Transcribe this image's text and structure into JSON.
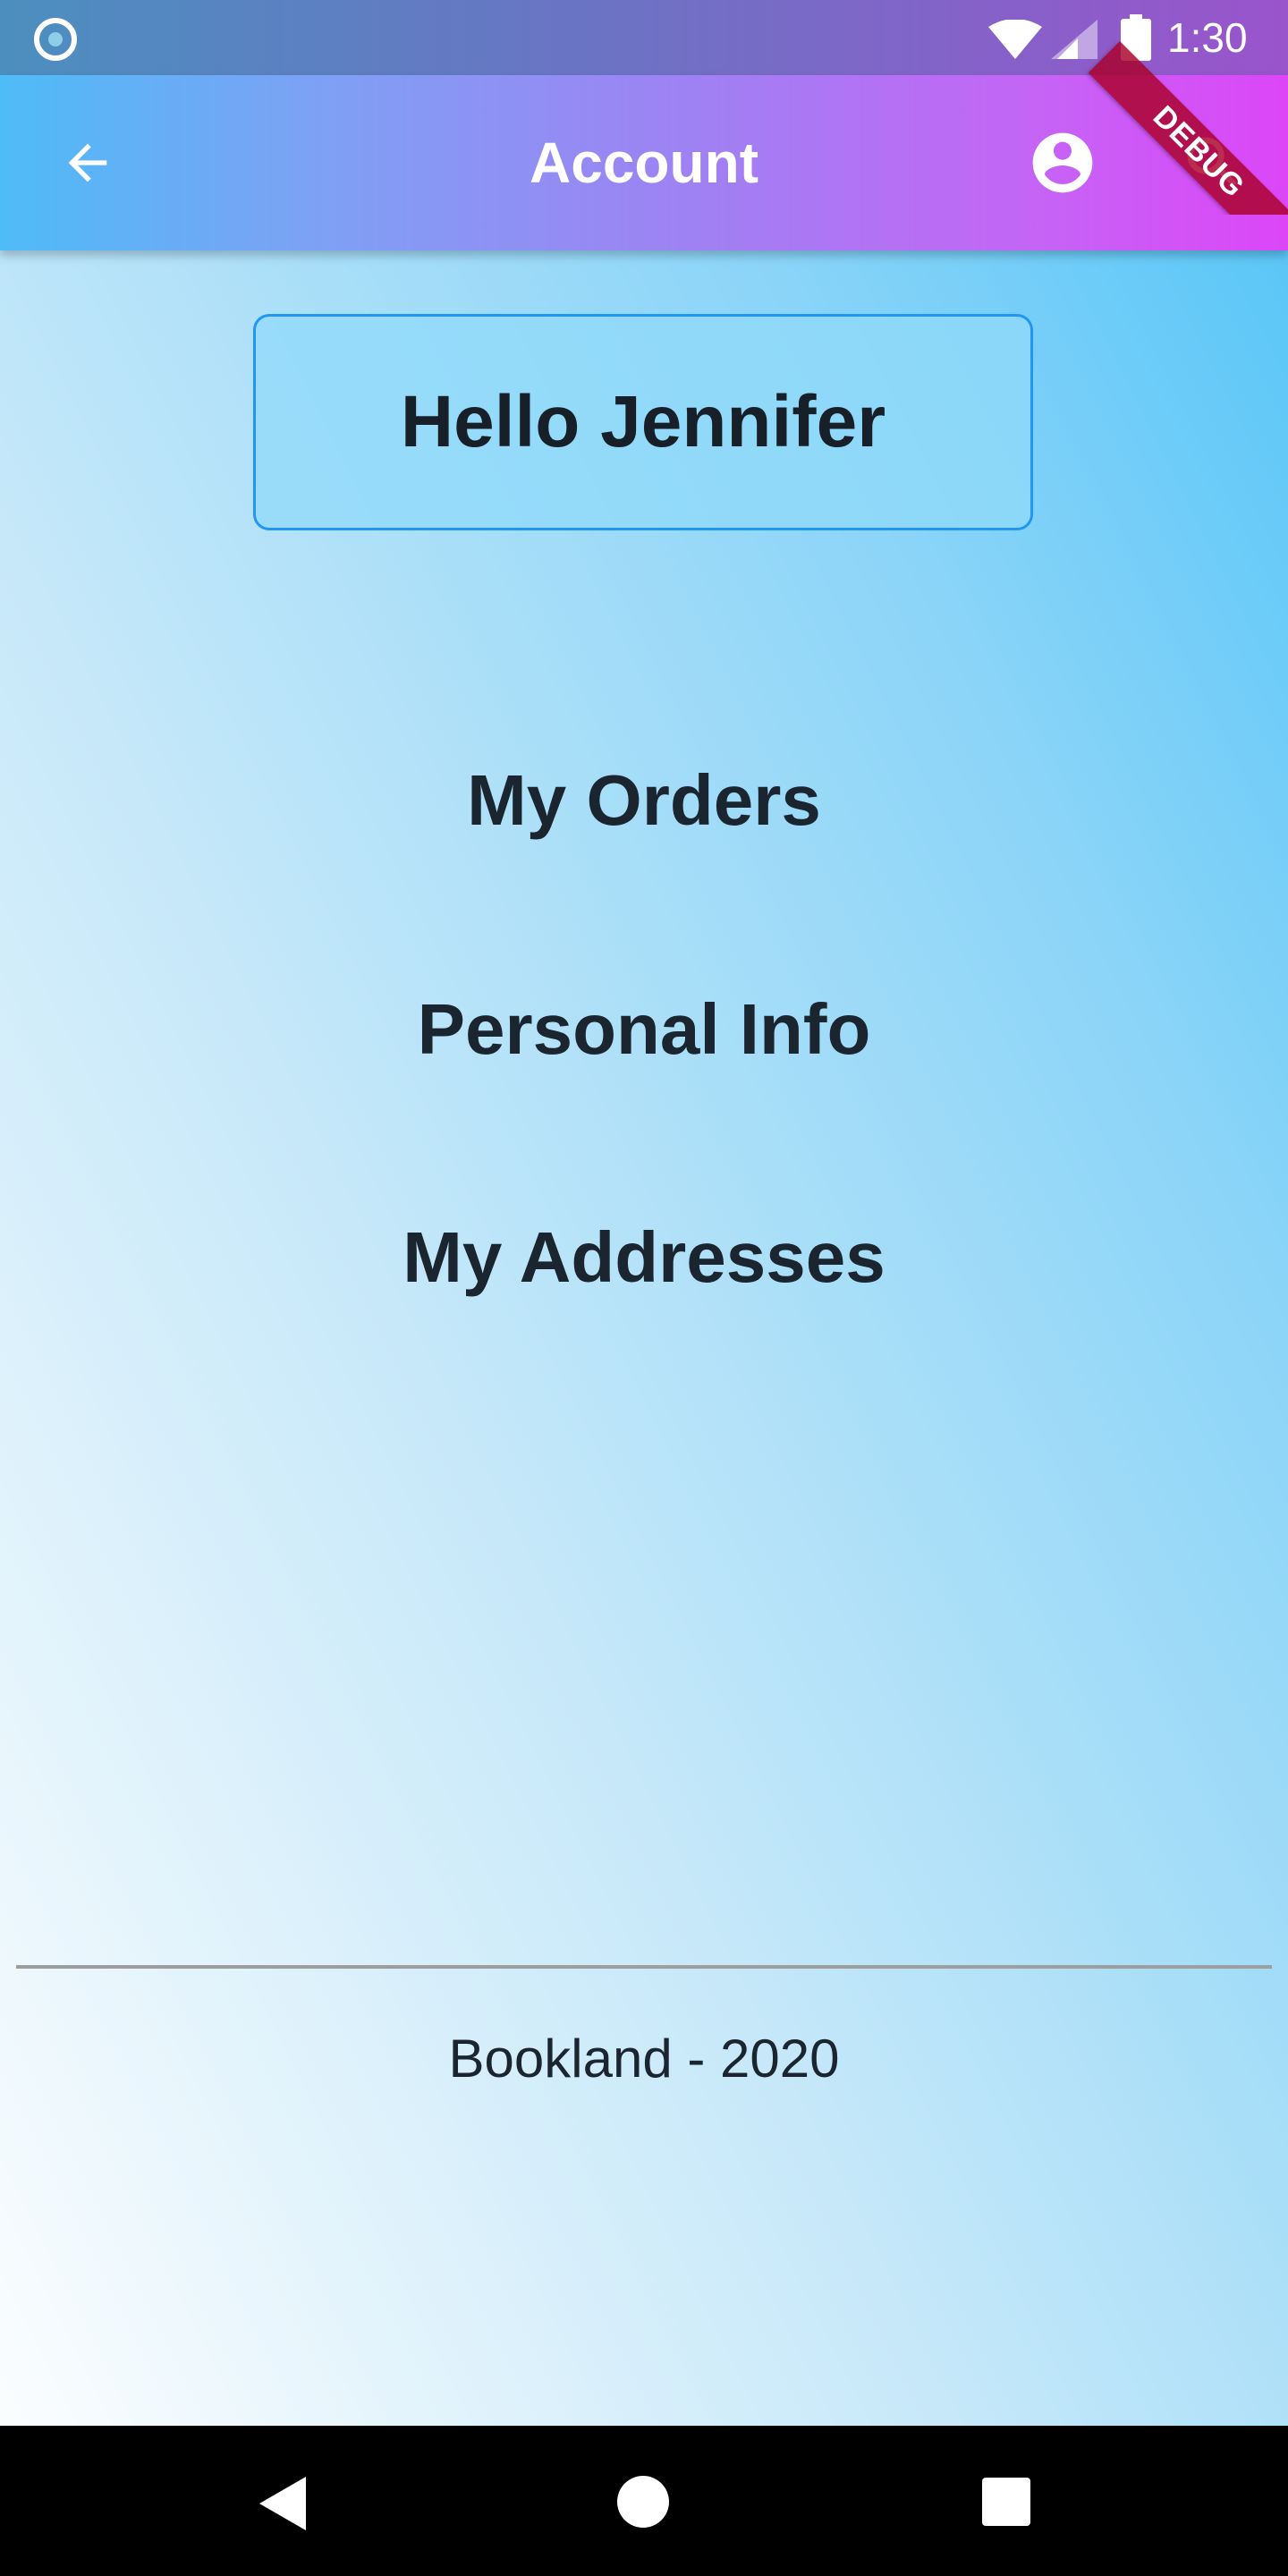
{
  "status_bar": {
    "time": "1:30",
    "icons": [
      "notification-circle-icon",
      "wifi-icon",
      "cellular-signal-icon",
      "battery-icon"
    ]
  },
  "app_bar": {
    "title": "Account",
    "back_icon": "arrow-back-icon",
    "account_icon": "account-circle-icon",
    "search_icon": "search-icon",
    "gradient": [
      "#4ebcf7",
      "#dc46f7"
    ]
  },
  "debug_banner": {
    "label": "DEBUG",
    "color": "#aa0028"
  },
  "greeting": {
    "text": "Hello Jennifer"
  },
  "menu": {
    "items": [
      {
        "label": "My Orders"
      },
      {
        "label": "Personal Info"
      },
      {
        "label": "My Addresses"
      }
    ]
  },
  "footer": {
    "text": "Bookland - 2020"
  },
  "nav_bar": {
    "icons": [
      "nav-back-icon",
      "nav-home-icon",
      "nav-recents-icon"
    ]
  },
  "colors": {
    "accent_border": "#2196f3",
    "text_dark": "#172029",
    "background_top": "#4fc3f7",
    "background_bottom": "#ffffff"
  }
}
